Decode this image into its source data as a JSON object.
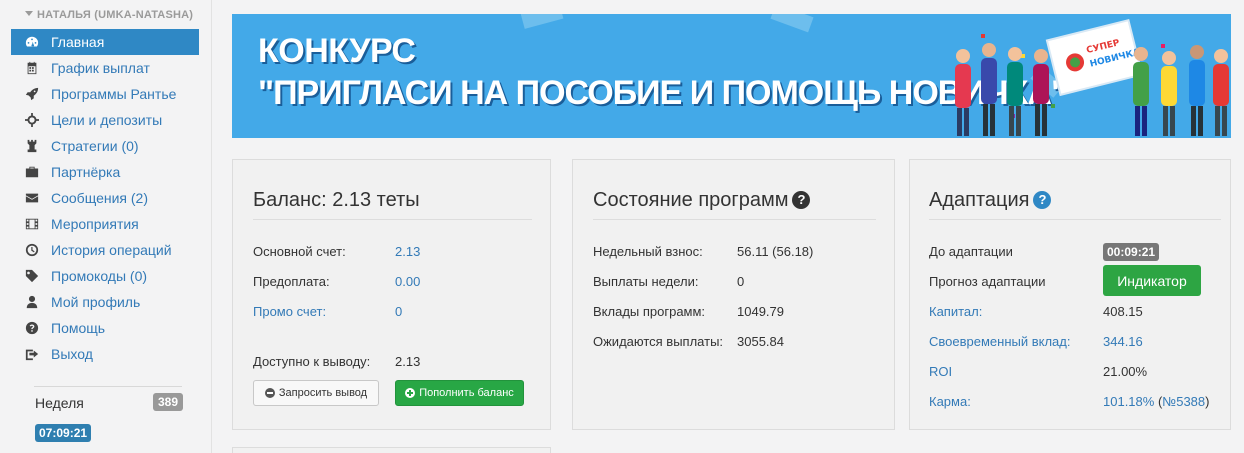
{
  "sidebar": {
    "user": "НАТАЛЬЯ (UMKA-NATASHA)",
    "items": [
      {
        "label": "Главная",
        "icon": "dashboard-icon"
      },
      {
        "label": "График выплат",
        "icon": "calendar-icon"
      },
      {
        "label": "Программы Рантье",
        "icon": "rocket-icon"
      },
      {
        "label": "Цели и депозиты",
        "icon": "crosshairs-icon"
      },
      {
        "label": "Стратегии (0)",
        "icon": "chess-rook-icon"
      },
      {
        "label": "Партнёрка",
        "icon": "briefcase-icon"
      },
      {
        "label": "Сообщения (2)",
        "icon": "envelope-icon"
      },
      {
        "label": "Мероприятия",
        "icon": "film-icon"
      },
      {
        "label": "История операций",
        "icon": "clock-icon"
      },
      {
        "label": "Промокоды (0)",
        "icon": "tag-icon"
      },
      {
        "label": "Мой профиль",
        "icon": "user-icon"
      },
      {
        "label": "Помощь",
        "icon": "question-circle-icon"
      },
      {
        "label": "Выход",
        "icon": "sign-out-icon"
      }
    ],
    "week_label": "Неделя",
    "week_count": "389",
    "week_timer": "07:09:21"
  },
  "banner": {
    "line1": "КОНКУРС",
    "line2": "\"ПРИГЛАСИ НА ПОСОБИЕ И ПОМОЩЬ НОВИЧКА\"",
    "sign_text": "СУПЕР НОВИЧКА"
  },
  "balance": {
    "title": "Баланс: 2.13 теты",
    "rows": [
      {
        "label": "Основной счет:",
        "value": "2.13"
      },
      {
        "label": "Предоплата:",
        "value": "0.00"
      },
      {
        "label": "Промо счет:",
        "value": "0"
      }
    ],
    "withdraw_label": "Доступно к выводу:",
    "withdraw_value": "2.13",
    "request_button": "Запросить вывод",
    "topup_button": "Пополнить баланс"
  },
  "programs": {
    "title": "Состояние программ",
    "rows": [
      {
        "label": "Недельный взнос:",
        "value": "56.11 (56.18)"
      },
      {
        "label": "Выплаты недели:",
        "value": "0"
      },
      {
        "label": "Вклады программ:",
        "value": "1049.79"
      },
      {
        "label": "Ожидаются выплаты:",
        "value": "3055.84"
      }
    ]
  },
  "adaptation": {
    "title": "Адаптация",
    "until_label": "До адаптации",
    "until_value": "00:09:21",
    "forecast_label": "Прогноз адаптации",
    "indicator_button": "Индикатор",
    "rows": [
      {
        "label": "Капитал:",
        "value": "408.15"
      },
      {
        "label": "Своевременный вклад:",
        "value": "344.16"
      },
      {
        "label": "ROI",
        "value": "21.00%"
      }
    ],
    "karma_label": "Карма:",
    "karma_value": "101.18%",
    "karma_rank": "№5388"
  },
  "colors": {
    "accent": "#2f88c5",
    "link": "#337ab7",
    "success": "#28a745",
    "banner_bg": "#43a9e8"
  }
}
